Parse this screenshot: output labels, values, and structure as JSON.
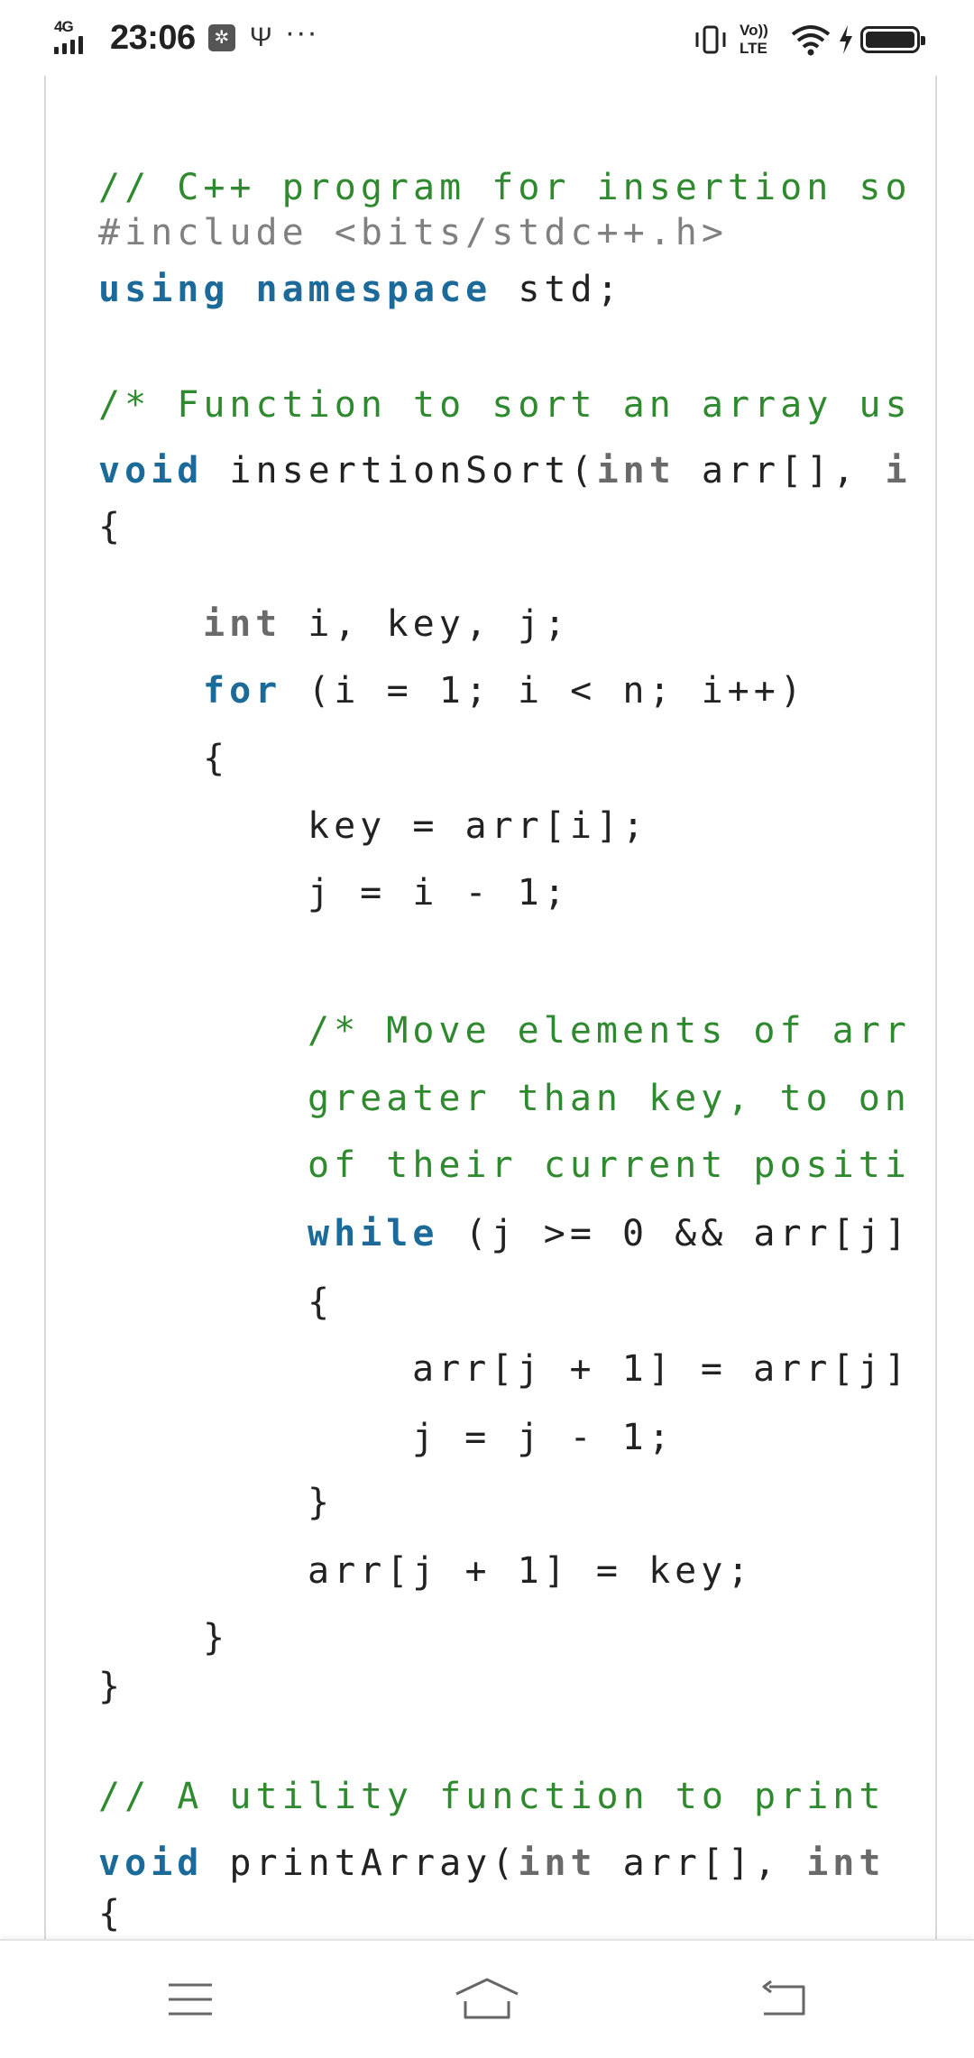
{
  "status_bar": {
    "network": "4G",
    "time": "23:06",
    "usb_debug_icon": "usb-debug-icon",
    "usb_icon": "usb-icon",
    "more_icon": "ellipsis-icon",
    "volte_line1": "Vo))",
    "volte_line2": "LTE",
    "icons_right": [
      "vibrate-icon",
      "volte-icon",
      "wifi-icon",
      "charging-icon",
      "battery-icon"
    ]
  },
  "code": {
    "lines": [
      {
        "indent": 0,
        "tokens": [
          {
            "t": "// C++ program for insertion so",
            "c": "com"
          }
        ]
      },
      {
        "indent": 0,
        "tokens": [
          {
            "t": "#include <bits/stdc++.h>",
            "c": "pre"
          }
        ]
      },
      {
        "indent": 0,
        "tokens": [
          {
            "t": "using namespace",
            "c": "kw"
          },
          {
            "t": " std;",
            "c": "pl"
          }
        ]
      },
      {
        "indent": 0,
        "tokens": [
          {
            "t": "/* Function to sort an array us",
            "c": "com"
          }
        ]
      },
      {
        "indent": 0,
        "tokens": [
          {
            "t": "void",
            "c": "kw"
          },
          {
            "t": " insertionSort(",
            "c": "pl"
          },
          {
            "t": "int",
            "c": "ty"
          },
          {
            "t": " arr[], ",
            "c": "pl"
          },
          {
            "t": "i",
            "c": "ty"
          }
        ]
      },
      {
        "indent": 0,
        "tokens": [
          {
            "t": "{",
            "c": "pl"
          }
        ]
      },
      {
        "indent": 1,
        "tokens": [
          {
            "t": "int",
            "c": "ty"
          },
          {
            "t": " i, key, j;",
            "c": "pl"
          }
        ]
      },
      {
        "indent": 1,
        "tokens": [
          {
            "t": "for",
            "c": "kw"
          },
          {
            "t": " (i = 1; i < n; i++)",
            "c": "pl"
          }
        ]
      },
      {
        "indent": 1,
        "tokens": [
          {
            "t": "{",
            "c": "pl"
          }
        ]
      },
      {
        "indent": 2,
        "tokens": [
          {
            "t": "key = arr[i];",
            "c": "pl"
          }
        ]
      },
      {
        "indent": 2,
        "tokens": [
          {
            "t": "j = i - 1;",
            "c": "pl"
          }
        ]
      },
      {
        "indent": 2,
        "tokens": [
          {
            "t": "/* Move elements of arr",
            "c": "com"
          }
        ]
      },
      {
        "indent": 2,
        "tokens": [
          {
            "t": "greater than key, to on",
            "c": "com"
          }
        ]
      },
      {
        "indent": 2,
        "tokens": [
          {
            "t": "of their current positi",
            "c": "com"
          }
        ]
      },
      {
        "indent": 2,
        "tokens": [
          {
            "t": "while",
            "c": "kw"
          },
          {
            "t": " (j >= 0 && arr[j]",
            "c": "pl"
          }
        ]
      },
      {
        "indent": 2,
        "tokens": [
          {
            "t": "{",
            "c": "pl"
          }
        ]
      },
      {
        "indent": 3,
        "tokens": [
          {
            "t": "arr[j + 1] = arr[j]",
            "c": "pl"
          }
        ]
      },
      {
        "indent": 3,
        "tokens": [
          {
            "t": "j = j - 1;",
            "c": "pl"
          }
        ]
      },
      {
        "indent": 2,
        "tokens": [
          {
            "t": "}",
            "c": "pl"
          }
        ]
      },
      {
        "indent": 2,
        "tokens": [
          {
            "t": "arr[j + 1] = key;",
            "c": "pl"
          }
        ]
      },
      {
        "indent": 1,
        "tokens": [
          {
            "t": "}",
            "c": "pl"
          }
        ]
      },
      {
        "indent": 0,
        "tokens": [
          {
            "t": "}",
            "c": "pl"
          }
        ]
      },
      {
        "indent": 0,
        "tokens": [
          {
            "t": "// A utility function to print",
            "c": "com"
          }
        ]
      },
      {
        "indent": 0,
        "tokens": [
          {
            "t": "void",
            "c": "kw"
          },
          {
            "t": " printArray(",
            "c": "pl"
          },
          {
            "t": "int",
            "c": "ty"
          },
          {
            "t": " arr[], ",
            "c": "pl"
          },
          {
            "t": "int",
            "c": "ty"
          }
        ]
      },
      {
        "indent": 0,
        "tokens": [
          {
            "t": "{",
            "c": "pl"
          }
        ]
      }
    ]
  },
  "nav_bar": {
    "menu_icon": "menu-icon",
    "home_icon": "home-icon",
    "back_icon": "back-icon"
  },
  "colors": {
    "comment": "#2f8a2f",
    "preprocessor": "#808080",
    "keyword": "#1b6a99",
    "type": "#6a6a6a",
    "plain": "#222222"
  }
}
